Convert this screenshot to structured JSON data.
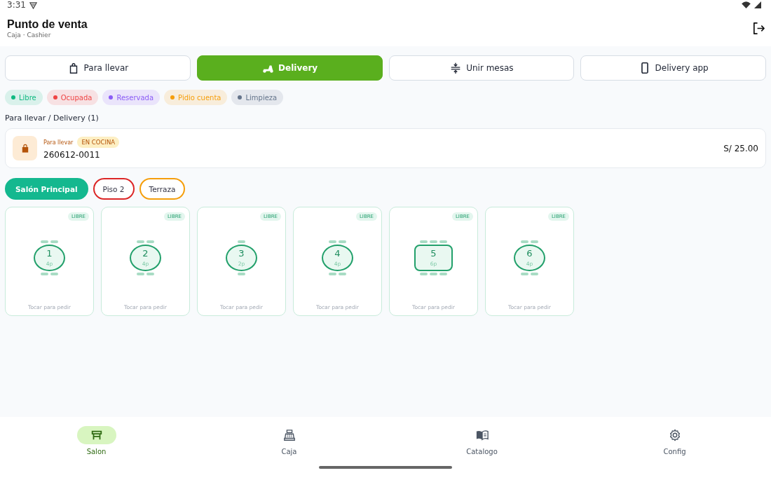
{
  "status_bar": {
    "time": "3:31"
  },
  "header": {
    "title": "Punto de venta",
    "subtitle": "Caja · Cashier"
  },
  "actions": [
    {
      "label": "Para llevar",
      "kind": "bag",
      "selected": false
    },
    {
      "label": "Delivery",
      "kind": "scooter",
      "selected": true
    },
    {
      "label": "Unir mesas",
      "kind": "merge",
      "selected": false
    },
    {
      "label": "Delivery app",
      "kind": "phone",
      "selected": false
    }
  ],
  "legend": [
    {
      "label": "Libre",
      "color": "#10b981"
    },
    {
      "label": "Ocupada",
      "color": "#ef4444"
    },
    {
      "label": "Reservada",
      "color": "#8b5cf6"
    },
    {
      "label": "Pidio cuenta",
      "color": "#f59e0b"
    },
    {
      "label": "Limpieza",
      "color": "#64748b"
    }
  ],
  "orders_title": "Para llevar / Delivery (1)",
  "orders": [
    {
      "type": "Para llevar",
      "status": "EN COCINA",
      "number": "260612-0011",
      "total": "S/ 25.00"
    }
  ],
  "zones": [
    {
      "label": "Salón Principal",
      "selected": true,
      "color": "#14b88f"
    },
    {
      "label": "Piso 2",
      "selected": false,
      "color": "#dc2626"
    },
    {
      "label": "Terraza",
      "selected": false,
      "color": "#f59e0b"
    }
  ],
  "tables": [
    {
      "number": "1",
      "capacity": "4p",
      "kind": "round4",
      "status": "LIBRE",
      "hint": "Tocar para pedir"
    },
    {
      "number": "2",
      "capacity": "4p",
      "kind": "round4",
      "status": "LIBRE",
      "hint": "Tocar para pedir"
    },
    {
      "number": "3",
      "capacity": "2p",
      "kind": "round2",
      "status": "LIBRE",
      "hint": "Tocar para pedir"
    },
    {
      "number": "4",
      "capacity": "4p",
      "kind": "round4",
      "status": "LIBRE",
      "hint": "Tocar para pedir"
    },
    {
      "number": "5",
      "capacity": "6p",
      "kind": "rect6",
      "status": "LIBRE",
      "hint": "Tocar para pedir"
    },
    {
      "number": "6",
      "capacity": "4p",
      "kind": "round4",
      "status": "LIBRE",
      "hint": "Tocar para pedir"
    }
  ],
  "nav": [
    {
      "label": "Salon",
      "kind": "table",
      "selected": true
    },
    {
      "label": "Caja",
      "kind": "register",
      "selected": false
    },
    {
      "label": "Catalogo",
      "kind": "book",
      "selected": false
    },
    {
      "label": "Config",
      "kind": "gear",
      "selected": false
    }
  ]
}
